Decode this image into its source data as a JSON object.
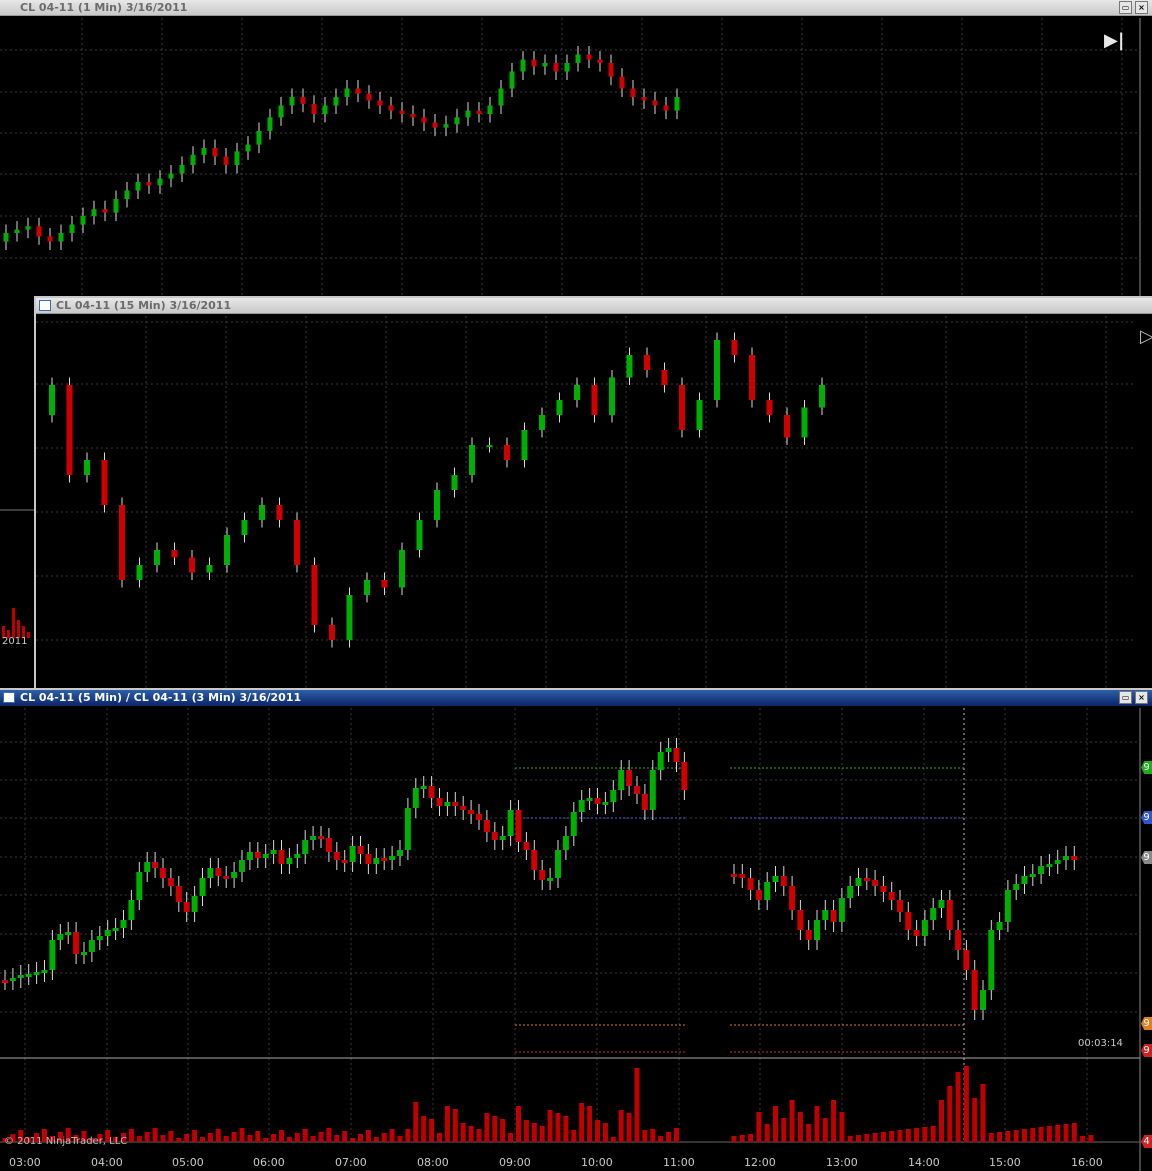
{
  "windows": {
    "w1": {
      "title": "CL 04-11 (1 Min)  3/16/2011"
    },
    "w2": {
      "title": "CL 04-11 (15 Min)  3/16/2011"
    },
    "w3": {
      "title": "CL 04-11 (5 Min) / CL 04-11 (3 Min)  3/16/2011"
    }
  },
  "bar_timer": "00:03:14",
  "copyright": "© 2011 NinjaTrader, LLC",
  "peek_label": "2011",
  "time_axis": [
    "03:00",
    "04:00",
    "05:00",
    "06:00",
    "07:00",
    "08:00",
    "09:00",
    "10:00",
    "11:00",
    "12:00",
    "13:00",
    "14:00",
    "15:00",
    "16:00"
  ],
  "price_markers": [
    {
      "label": "9",
      "color": "#22aa22"
    },
    {
      "label": "9",
      "color": "#3355cc"
    },
    {
      "label": "9",
      "color": "#888888"
    },
    {
      "label": "9",
      "color": "#e08020"
    },
    {
      "label": "9",
      "color": "#cc2222"
    },
    {
      "label": "4",
      "color": "#cc2222"
    }
  ],
  "colors": {
    "up": "#00b000",
    "down": "#d00000",
    "volume": "#c00000",
    "grid": "#3a3a3a",
    "wick": "#d8d8d8"
  },
  "chart_data": [
    {
      "type": "candlestick",
      "name": "CL 04-11 (1 Min)",
      "close": [
        96.1,
        96.12,
        96.14,
        96.08,
        96.05,
        96.1,
        96.15,
        96.2,
        96.24,
        96.22,
        96.3,
        96.35,
        96.4,
        96.38,
        96.42,
        96.45,
        96.5,
        96.56,
        96.6,
        96.55,
        96.5,
        96.58,
        96.62,
        96.7,
        96.78,
        96.85,
        96.9,
        96.86,
        96.8,
        96.85,
        96.9,
        96.95,
        96.92,
        96.88,
        96.85,
        96.82,
        96.8,
        96.78,
        96.75,
        96.72,
        96.74,
        96.78,
        96.82,
        96.8,
        96.85,
        96.95,
        97.05,
        97.12,
        97.08,
        97.1,
        97.05,
        97.1,
        97.15,
        97.12,
        97.1,
        97.02,
        96.95,
        96.9,
        96.88,
        96.85,
        96.82,
        96.9
      ],
      "open": [
        96.05,
        96.1,
        96.12,
        96.14,
        96.08,
        96.05,
        96.1,
        96.15,
        96.2,
        96.24,
        96.22,
        96.3,
        96.35,
        96.4,
        96.38,
        96.42,
        96.45,
        96.5,
        96.56,
        96.6,
        96.55,
        96.5,
        96.58,
        96.62,
        96.7,
        96.78,
        96.85,
        96.9,
        96.86,
        96.8,
        96.85,
        96.9,
        96.95,
        96.92,
        96.88,
        96.85,
        96.82,
        96.8,
        96.78,
        96.75,
        96.72,
        96.74,
        96.78,
        96.82,
        96.8,
        96.85,
        96.95,
        97.05,
        97.12,
        97.08,
        97.1,
        97.05,
        97.1,
        97.15,
        97.12,
        97.1,
        97.02,
        96.95,
        96.9,
        96.88,
        96.85,
        96.82
      ]
    },
    {
      "type": "candlestick",
      "name": "CL 04-11 (15 Min)",
      "close": [
        97.9,
        97.3,
        97.4,
        97.1,
        96.6,
        96.7,
        96.8,
        96.75,
        96.65,
        96.7,
        96.9,
        97.0,
        97.1,
        97.0,
        96.7,
        96.3,
        96.2,
        96.5,
        96.6,
        96.55,
        96.8,
        97.0,
        97.2,
        97.3,
        97.5,
        97.5,
        97.4,
        97.6,
        97.7,
        97.8,
        97.9,
        97.7,
        97.95,
        98.1,
        98.0,
        97.9,
        97.6,
        97.8,
        98.2,
        98.1,
        97.8,
        97.7,
        97.55,
        97.75,
        97.9
      ],
      "open": [
        97.7,
        97.9,
        97.3,
        97.4,
        97.1,
        96.6,
        96.7,
        96.8,
        96.75,
        96.65,
        96.7,
        96.9,
        97.0,
        97.1,
        97.0,
        96.7,
        96.3,
        96.2,
        96.5,
        96.6,
        96.55,
        96.8,
        97.0,
        97.2,
        97.3,
        97.5,
        97.5,
        97.4,
        97.6,
        97.7,
        97.8,
        97.9,
        97.7,
        97.95,
        98.1,
        98.0,
        97.9,
        97.6,
        97.8,
        98.2,
        98.1,
        97.8,
        97.7,
        97.55,
        97.75
      ]
    },
    {
      "type": "candlestick",
      "name": "CL 04-11 (5 Min) / CL 04-11 (3 Min)",
      "x": [
        "03:00",
        "04:00",
        "05:00",
        "06:00",
        "07:00",
        "08:00",
        "09:00",
        "10:00",
        "11:00",
        "12:00",
        "13:00",
        "14:00",
        "15:00",
        "16:00"
      ],
      "note": "series shown with gap between 11:00 and 11:40; volume subpanel below"
    }
  ]
}
